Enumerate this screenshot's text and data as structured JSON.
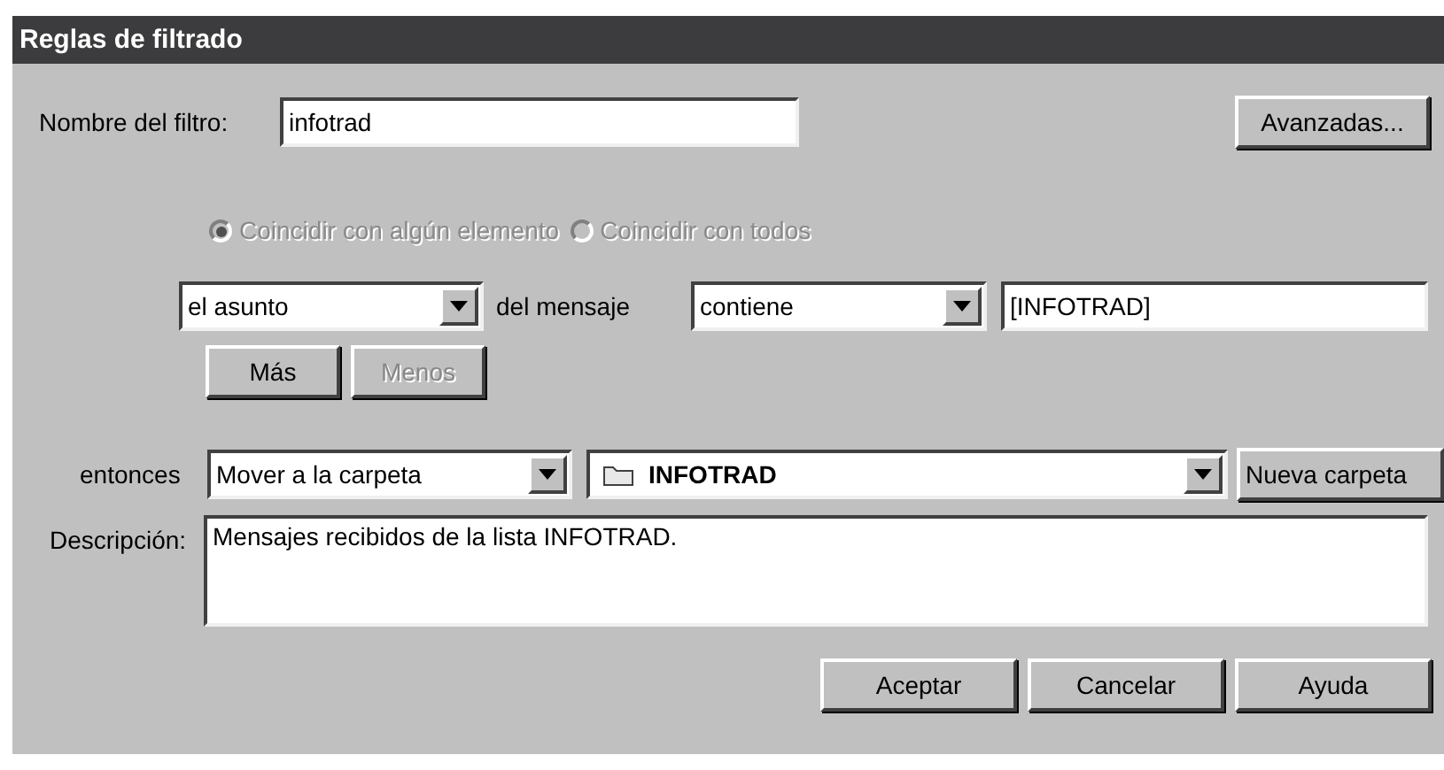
{
  "window": {
    "title": "Reglas de filtrado"
  },
  "filter_name": {
    "label": "Nombre del filtro:",
    "value": "infotrad"
  },
  "advanced_button": {
    "label": "Avanzadas..."
  },
  "match_options": [
    {
      "label": "Coincidir con algún elemento",
      "selected": true,
      "disabled": true
    },
    {
      "label": "Coincidir con todos",
      "selected": false,
      "disabled": true
    }
  ],
  "condition": {
    "field": "el asunto",
    "connector": "del mensaje",
    "operator": "contiene",
    "value": "[INFOTRAD]"
  },
  "condition_buttons": [
    {
      "label": "Más",
      "disabled": false
    },
    {
      "label": "Menos",
      "disabled": true
    }
  ],
  "action": {
    "label": "entonces",
    "action": "Mover a la carpeta",
    "folder": "INFOTRAD",
    "new_folder_button": "Nueva carpeta"
  },
  "description": {
    "label": "Descripción:",
    "value": "Mensajes recibidos de la lista INFOTRAD."
  },
  "buttons": [
    "Aceptar",
    "Cancelar",
    "Ayuda"
  ]
}
